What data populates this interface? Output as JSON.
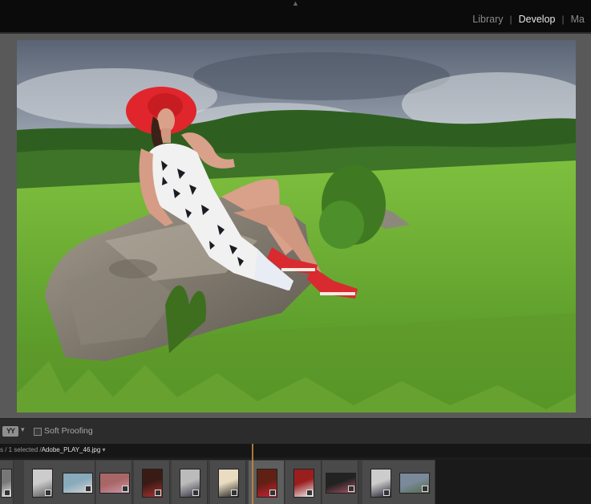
{
  "modules": {
    "items": [
      "Library",
      "Develop",
      "Ma"
    ],
    "active": "Develop"
  },
  "photo": {
    "filename": "Adobe_PLAY_46.jpg"
  },
  "toolbar": {
    "view_mode_label": "YY",
    "soft_proofing_label": "Soft Proofing",
    "soft_proofing_checked": false
  },
  "filmstrip": {
    "selection_prefix": "s / 1 selected /",
    "selected_file": "Adobe_PLAY_46.jpg",
    "selected_suffix": " ▾",
    "thumbnails": [
      {
        "name": "thumb-1",
        "colors": [
          "#777",
          "#ddd"
        ]
      },
      {
        "name": "thumb-2",
        "colors": [
          "#ccc",
          "#555"
        ]
      },
      {
        "name": "thumb-3",
        "colors": [
          "#8ab",
          "#d6d6d6"
        ]
      },
      {
        "name": "thumb-4",
        "colors": [
          "#a66",
          "#c9a"
        ]
      },
      {
        "name": "thumb-5",
        "colors": [
          "#3a1a14",
          "#a33"
        ]
      },
      {
        "name": "thumb-6",
        "colors": [
          "#bbb",
          "#334"
        ]
      },
      {
        "name": "thumb-7",
        "colors": [
          "#e9dcc0",
          "#222"
        ]
      },
      {
        "name": "thumb-8",
        "colors": [
          "#602014",
          "#c23"
        ]
      },
      {
        "name": "thumb-9",
        "colors": [
          "#9a1e1e",
          "#eee"
        ]
      },
      {
        "name": "thumb-10",
        "colors": [
          "#222",
          "#a56"
        ]
      },
      {
        "name": "thumb-11",
        "colors": [
          "#ccc",
          "#223"
        ]
      },
      {
        "name": "thumb-12",
        "colors": [
          "#7a8a9a",
          "#556b4a"
        ]
      }
    ]
  },
  "colors": {
    "accent": "#c9873e",
    "module_active": "#e6e6e6",
    "module_inactive": "#8a8a8a"
  }
}
